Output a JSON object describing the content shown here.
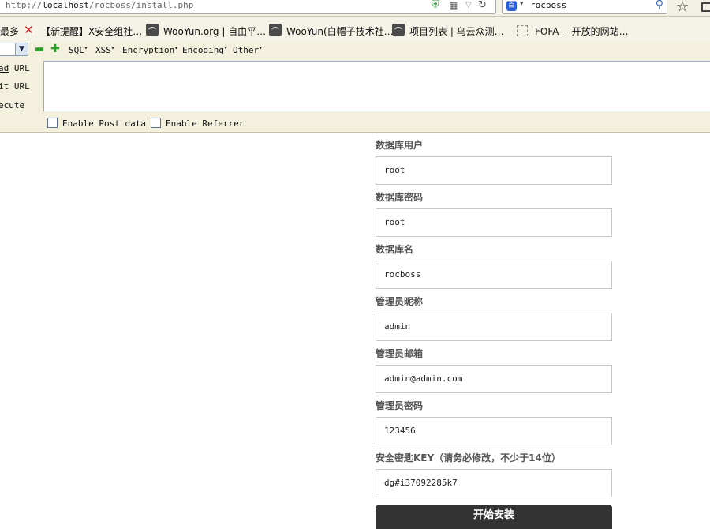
{
  "urlbar": {
    "url_prefix": "http://",
    "url_host": "localhost",
    "url_path": "/rocboss/install.php",
    "search_text": "rocboss"
  },
  "bookmarks": [
    {
      "label": "最多"
    },
    {
      "label": "【新提醒】X安全组社…"
    },
    {
      "label": "WooYun.org | 自由平…"
    },
    {
      "label": "WooYun(白帽子技术社…"
    },
    {
      "label": "项目列表 | 乌云众测…"
    },
    {
      "label": "FOFA -- 开放的网站…"
    }
  ],
  "hackbar": {
    "menus": [
      {
        "label": "SQL"
      },
      {
        "label": "XSS"
      },
      {
        "label": "Encryption"
      },
      {
        "label": "Encoding"
      },
      {
        "label": "Other"
      }
    ],
    "actions": [
      {
        "pre": "",
        "u": "ad",
        "post": " URL"
      },
      {
        "pre": "",
        "u": "",
        "post": "it URL"
      },
      {
        "pre": "",
        "u": "",
        "post": "ecute"
      }
    ],
    "enable_post": "Enable Post data",
    "enable_referrer": "Enable Referrer"
  },
  "form": {
    "fields": [
      {
        "label": "数据库用户",
        "value": "root"
      },
      {
        "label": "数据库密码",
        "value": "root"
      },
      {
        "label": "数据库名",
        "value": "rocboss"
      },
      {
        "label": "管理员昵称",
        "value": "admin"
      },
      {
        "label": "管理员邮箱",
        "value": "admin@admin.com"
      },
      {
        "label": "管理员密码",
        "value": "123456"
      },
      {
        "label": "安全密匙KEY（请务必修改，不少于14位）",
        "value": "dg#i37092285k7"
      }
    ],
    "submit_label": "开始安装"
  },
  "colors": {
    "chrome_bg": "#f3f1e6",
    "hackbar_bg": "#f3f0dd",
    "button_bg": "#333333",
    "label_color": "#555555"
  }
}
